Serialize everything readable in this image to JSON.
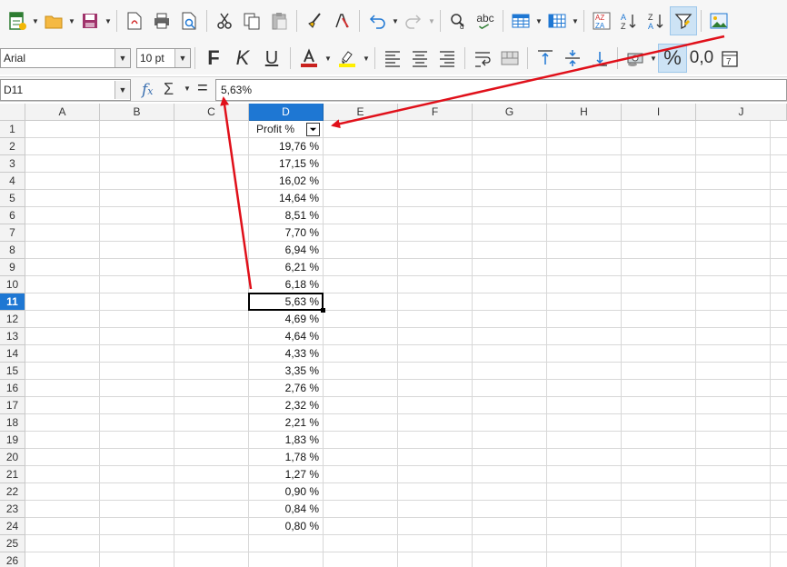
{
  "toolbar": {
    "font_name": "Arial",
    "font_size": "10 pt",
    "bold_label": "F",
    "italic_label": "K",
    "underline_label": "U",
    "spell_label": "abc",
    "percent_label": "%",
    "decimal_label": "0,0"
  },
  "formula_bar": {
    "cell_ref": "D11",
    "formula": "5,63%"
  },
  "columns": [
    "A",
    "B",
    "C",
    "D",
    "E",
    "F",
    "G",
    "H",
    "I",
    "J"
  ],
  "selected_column": "D",
  "rows": [
    "1",
    "2",
    "3",
    "4",
    "5",
    "6",
    "7",
    "8",
    "9",
    "10",
    "11",
    "12",
    "13",
    "14",
    "15",
    "16",
    "17",
    "18",
    "19",
    "20",
    "21",
    "22",
    "23",
    "24",
    "25",
    "26"
  ],
  "selected_row": "11",
  "sheet": {
    "header_label": "Profit %",
    "values": [
      "19,76 %",
      "17,15 %",
      "16,02 %",
      "14,64 %",
      "8,51 %",
      "7,70 %",
      "6,94 %",
      "6,21 %",
      "6,18 %",
      "5,63 %",
      "4,69 %",
      "4,64 %",
      "4,33 %",
      "3,35 %",
      "2,76 %",
      "2,32 %",
      "2,21 %",
      "1,83 %",
      "1,78 %",
      "1,27 %",
      "0,90 %",
      "0,84 %",
      "0,80 %"
    ]
  },
  "colors": {
    "accent": "#1e77d3",
    "annotation_arrow": "#e0101a"
  }
}
